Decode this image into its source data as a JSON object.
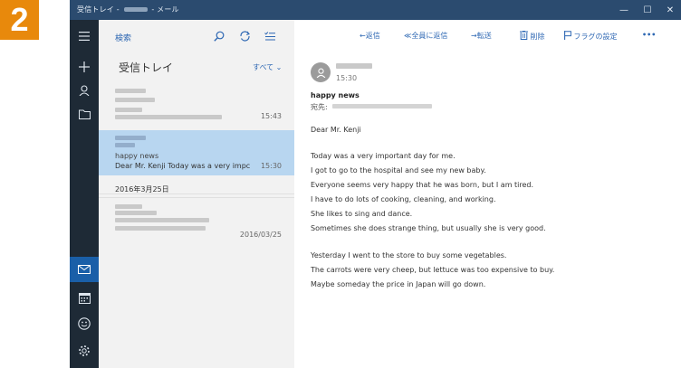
{
  "step_badge": "2",
  "window": {
    "title_prefix": "受信トレイ - ",
    "title_suffix": " - メール",
    "controls": {
      "minimize": "—",
      "maximize": "☐",
      "close": "✕"
    }
  },
  "rail": {
    "icons": [
      "hamburger-icon",
      "plus-icon",
      "person-icon",
      "folder-icon",
      "mail-icon",
      "calendar-icon",
      "smiley-icon",
      "settings-icon"
    ]
  },
  "list": {
    "search_placeholder": "検索",
    "folder_title": "受信トレイ",
    "filter_label": "すべて ⌄",
    "items": [
      {
        "time": "15:43",
        "subject": "",
        "preview": ""
      },
      {
        "time": "15:30",
        "subject": "happy news",
        "preview": "Dear Mr. Kenji Today was a very impc"
      },
      {
        "time": "2016/03/25",
        "subject": "",
        "preview": ""
      }
    ],
    "date_group": "2016年3月25日"
  },
  "reader": {
    "commands": {
      "reply": "←返信",
      "reply_all": "≪全員に返信",
      "forward": "→転送",
      "delete": "削除",
      "flag": "フラグの設定",
      "more": "•••"
    },
    "time": "15:30",
    "subject": "happy news",
    "to_label": "宛先:",
    "greeting": "Dear Mr. Kenji",
    "body": [
      "Today was a very important day for me.",
      "I got to go to the hospital and see my new baby.",
      "Everyone seems very happy that he was born, but I am tired.",
      "I have to do lots of cooking, cleaning, and working.",
      "She likes to sing and dance.",
      "Sometimes she does strange thing, but usually she is very good.",
      "Yesterday I went to the store to buy some vegetables.",
      "The carrots were very cheep, but lettuce was too expensive to buy.",
      "Maybe someday the price in Japan will go down."
    ]
  },
  "colors": {
    "badge": "#e8890c",
    "titlebar": "#2b4b6f",
    "rail": "#1e2a36",
    "rail_active": "#1a5fa8",
    "selected_item": "#b8d6f0",
    "accent": "#2d67b3"
  }
}
